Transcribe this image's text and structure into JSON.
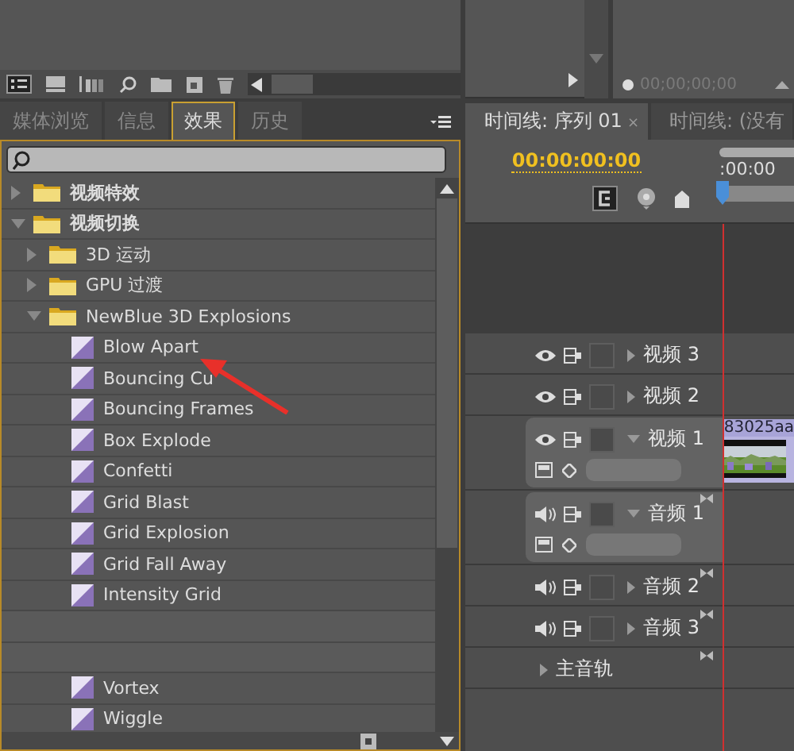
{
  "source_monitor": {
    "timecode": "00;00;00;00"
  },
  "tabs": [
    {
      "label": "媒体浏览",
      "selected": false
    },
    {
      "label": "信息",
      "selected": false
    },
    {
      "label": "效果",
      "selected": true
    },
    {
      "label": "历史",
      "selected": false
    }
  ],
  "effects_tree": [
    {
      "kind": "folder",
      "label": "视频特效",
      "expanded": false
    },
    {
      "kind": "folder",
      "label": "视频切换",
      "expanded": true,
      "children": [
        {
          "kind": "folder",
          "label": "3D 运动",
          "expanded": false
        },
        {
          "kind": "folder",
          "label": "GPU 过渡",
          "expanded": false
        },
        {
          "kind": "folder",
          "label": "NewBlue 3D Explosions",
          "expanded": true,
          "children": [
            {
              "kind": "effect",
              "label": "Blow Apart"
            },
            {
              "kind": "effect",
              "label": "Bouncing Cu"
            },
            {
              "kind": "effect",
              "label": "Bouncing Frames"
            },
            {
              "kind": "effect",
              "label": "Box Explode"
            },
            {
              "kind": "effect",
              "label": "Confetti"
            },
            {
              "kind": "effect",
              "label": "Grid Blast"
            },
            {
              "kind": "effect",
              "label": "Grid Explosion"
            },
            {
              "kind": "effect",
              "label": "Grid Fall Away"
            },
            {
              "kind": "effect",
              "label": "Intensity Grid"
            },
            {
              "kind": "obscured"
            },
            {
              "kind": "obscured"
            },
            {
              "kind": "effect",
              "label": "Vortex"
            },
            {
              "kind": "effect",
              "label": "Wiggle"
            }
          ]
        }
      ]
    }
  ],
  "timeline_tabs": [
    {
      "label": "时间线: 序列 01",
      "selected": true,
      "close_mark": "×"
    },
    {
      "label": "时间线: (没有",
      "selected": false
    }
  ],
  "timeline": {
    "timecode": "00:00:00:00",
    "ruler_label": ":00:00",
    "tracks": [
      {
        "kind": "video",
        "name": "视频 3",
        "expanded": false
      },
      {
        "kind": "video",
        "name": "视频 2",
        "expanded": false
      },
      {
        "kind": "video",
        "name": "视频 1",
        "expanded": true
      },
      {
        "kind": "audio",
        "name": "音频 1",
        "expanded": true
      },
      {
        "kind": "audio",
        "name": "音频 2",
        "expanded": false
      },
      {
        "kind": "audio",
        "name": "音频 3",
        "expanded": false
      },
      {
        "kind": "master",
        "name": "主音轨",
        "expanded": false
      }
    ],
    "clip": {
      "name": "83025aa"
    }
  }
}
